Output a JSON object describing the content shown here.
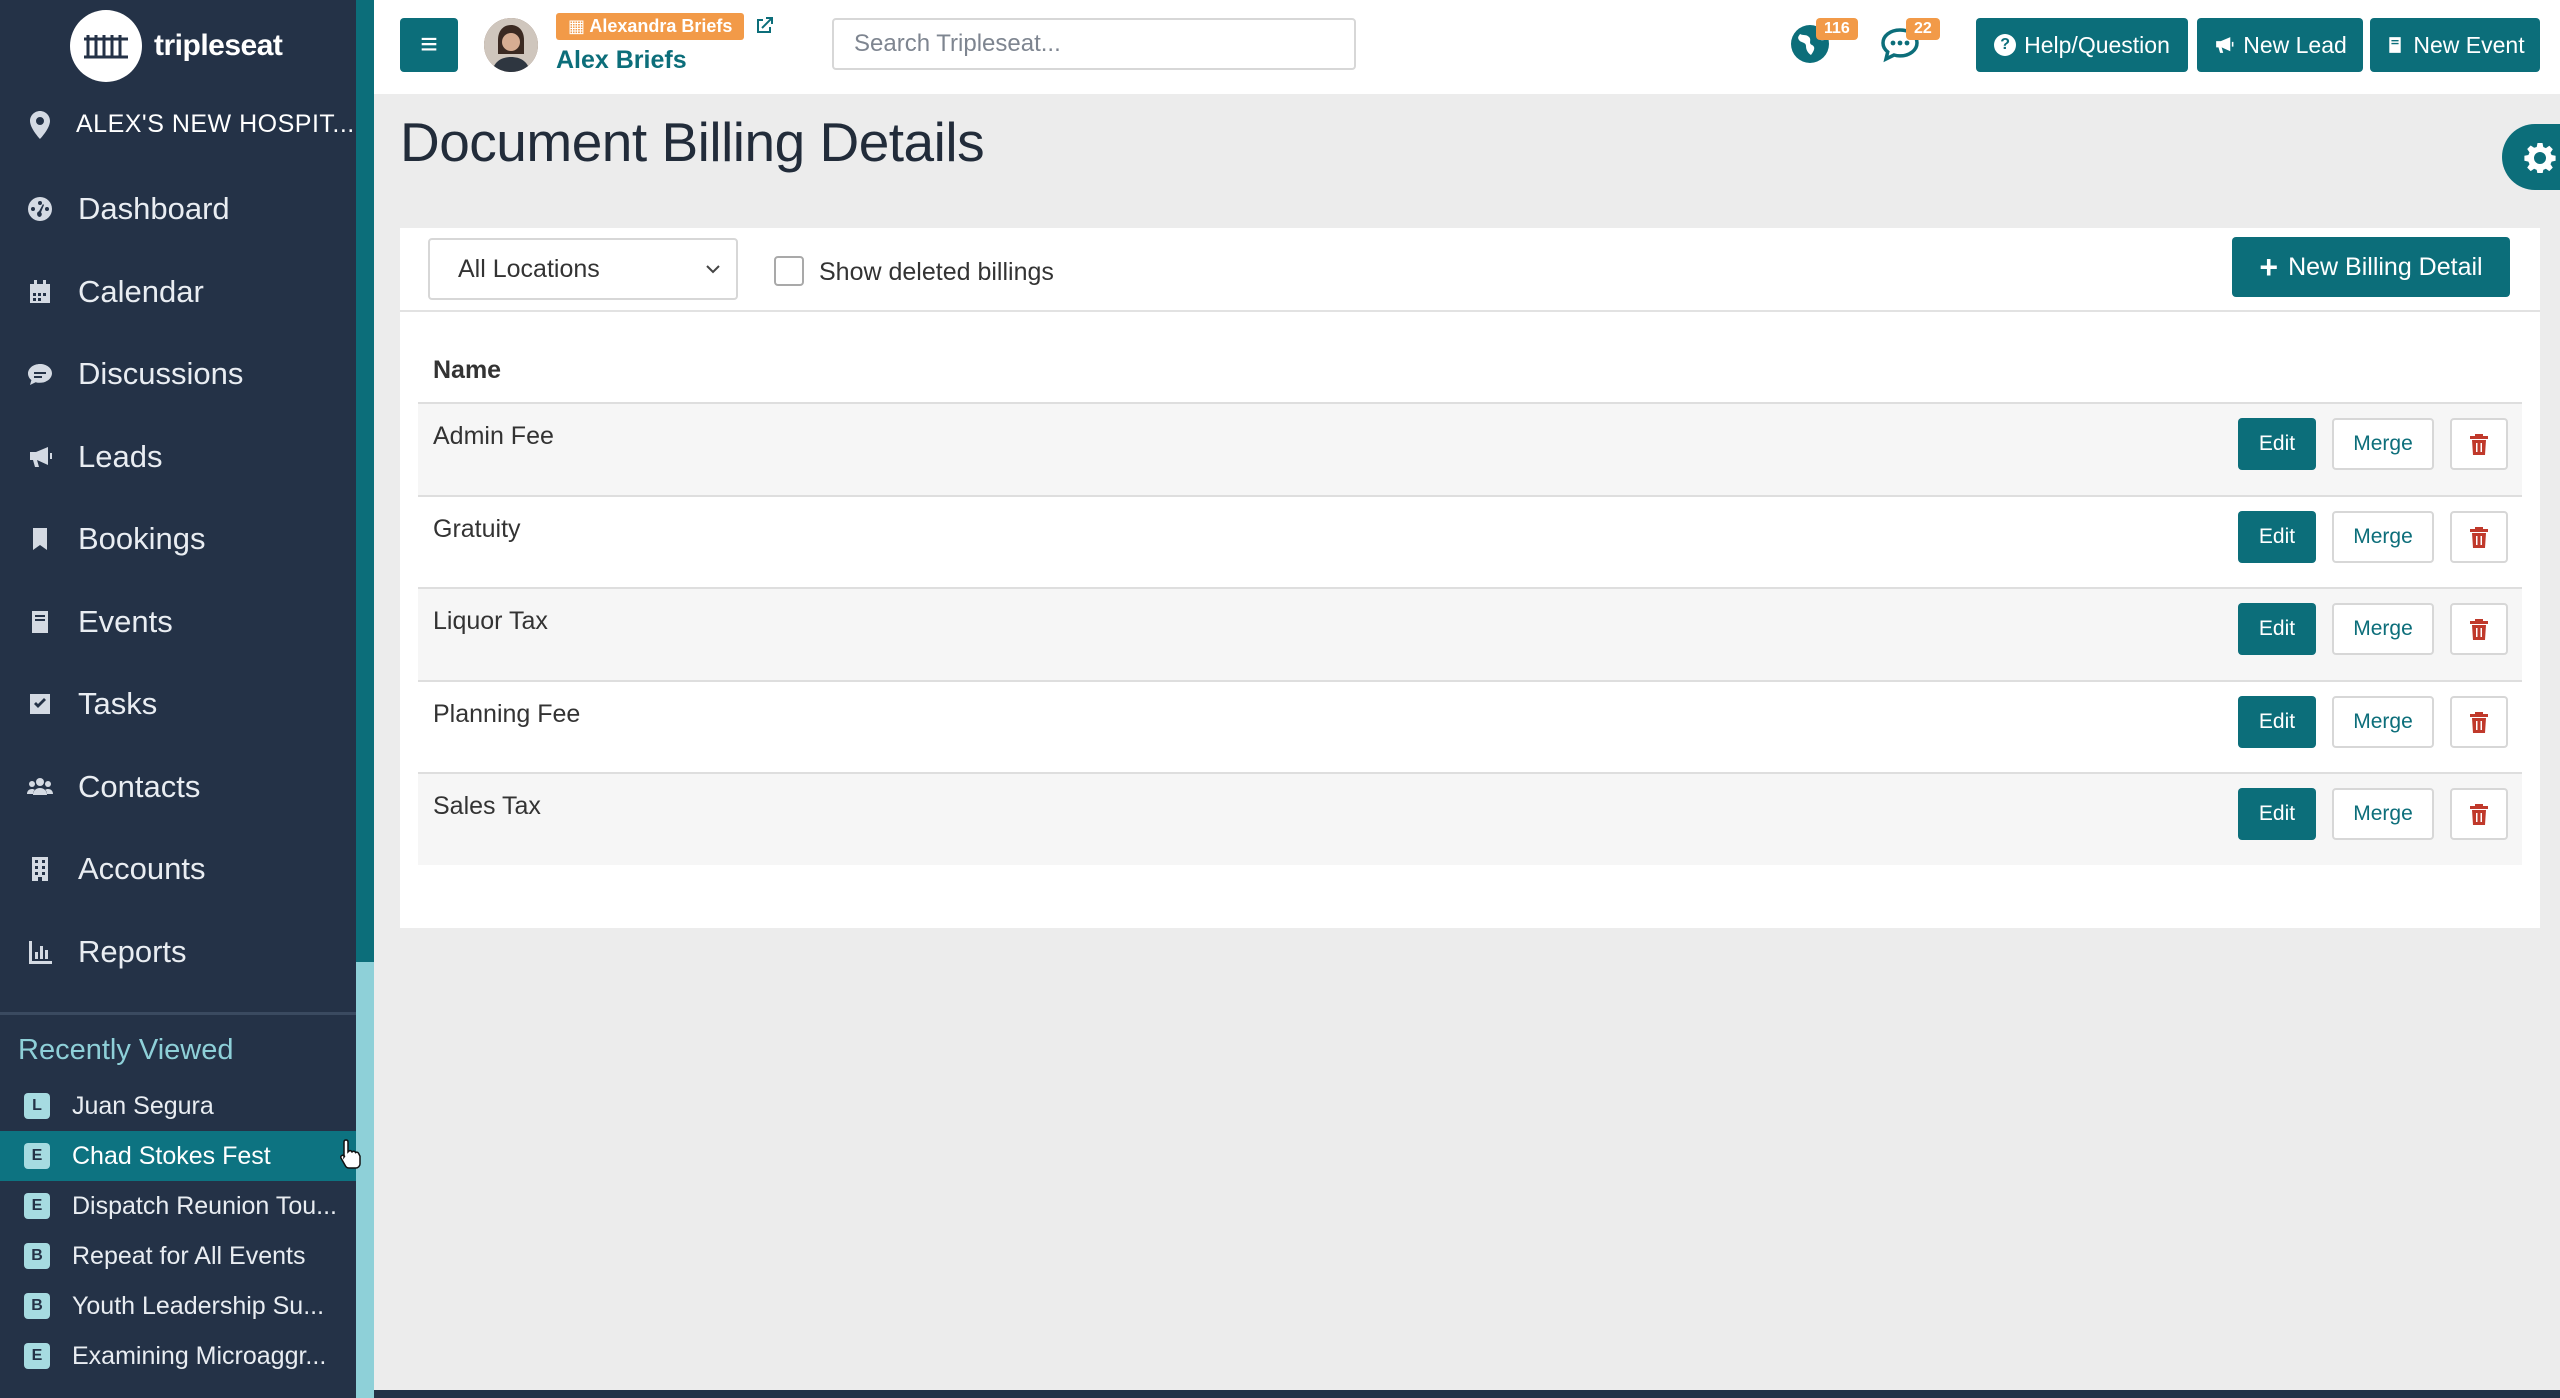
{
  "app": {
    "logo_text": "tripleseat"
  },
  "sidebar": {
    "location": "ALEX'S NEW HOSPIT...",
    "items": [
      {
        "label": "Dashboard",
        "icon": "dashboard-icon"
      },
      {
        "label": "Calendar",
        "icon": "calendar-icon"
      },
      {
        "label": "Discussions",
        "icon": "discussions-icon"
      },
      {
        "label": "Leads",
        "icon": "megaphone-icon"
      },
      {
        "label": "Bookings",
        "icon": "bookmark-icon"
      },
      {
        "label": "Events",
        "icon": "book-icon"
      },
      {
        "label": "Tasks",
        "icon": "checkbox-icon"
      },
      {
        "label": "Contacts",
        "icon": "users-icon"
      },
      {
        "label": "Accounts",
        "icon": "building-icon"
      },
      {
        "label": "Reports",
        "icon": "bar-chart-icon"
      }
    ],
    "recent_title": "Recently Viewed",
    "recent": [
      {
        "badge": "L",
        "label": "Juan Segura"
      },
      {
        "badge": "E",
        "label": "Chad Stokes Fest"
      },
      {
        "badge": "E",
        "label": "Dispatch Reunion Tou..."
      },
      {
        "badge": "B",
        "label": "Repeat for All Events"
      },
      {
        "badge": "B",
        "label": "Youth Leadership Su..."
      },
      {
        "badge": "E",
        "label": "Examining Microaggr..."
      }
    ]
  },
  "header": {
    "user_tag": "Alexandra Briefs",
    "user_name": "Alex Briefs",
    "search_placeholder": "Search Tripleseat...",
    "globe_count": "116",
    "chat_count": "22",
    "help_label": "Help/Question",
    "new_lead_label": "New Lead",
    "new_event_label": "New Event"
  },
  "page": {
    "title": "Document Billing Details",
    "location_select": "All Locations",
    "show_deleted_label": "Show deleted billings",
    "new_billing_label": "New Billing Detail",
    "column_name": "Name",
    "edit_label": "Edit",
    "merge_label": "Merge",
    "rows": [
      "Admin Fee",
      "Gratuity",
      "Liquor Tax",
      "Planning Fee",
      "Sales Tax"
    ]
  },
  "colors": {
    "accent": "#0c6e7a",
    "sidebar": "#243247",
    "badge": "#f29a48",
    "danger": "#c0392b"
  }
}
